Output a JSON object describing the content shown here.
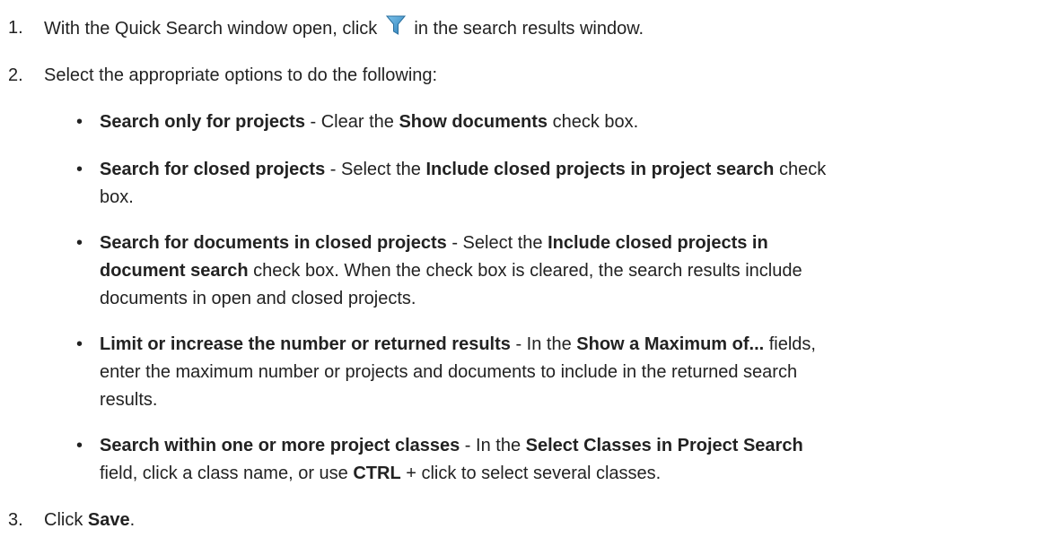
{
  "steps": {
    "step1": {
      "number": "1.",
      "text_before": "With the Quick Search window open, click",
      "text_after": "in the search results window."
    },
    "step2": {
      "number": "2.",
      "text": "Select the appropriate options to do the following:"
    },
    "step3": {
      "number": "3.",
      "text_before": "Click",
      "bold": "Save",
      "text_after": "."
    }
  },
  "bullets": {
    "b1": {
      "title": "Search only for projects",
      "t1": " - Clear the ",
      "b1": "Show documents",
      "t2": " check box."
    },
    "b2": {
      "title": "Search for closed projects",
      "t1": " - Select the ",
      "b1": "Include closed projects in project search",
      "t2": " check",
      "line2": "box."
    },
    "b3": {
      "title": "Search for documents in closed projects",
      "t1": " - Select the ",
      "b1": "Include closed projects in",
      "line2_bold": "document search",
      "line2_t": " check box. When the check box is cleared, the search results include",
      "line3": "documents in open and closed projects."
    },
    "b4": {
      "title": "Limit or increase the number or returned results",
      "t1": " - In the ",
      "b1": "Show a Maximum of...",
      "t2": " fields,",
      "line2": "enter the maximum number or projects and documents to include in the returned search",
      "line3": "results."
    },
    "b5": {
      "title": "Search within one or more project classes",
      "t1": " - In the ",
      "b1": "Select Classes in Project Search",
      "line2_t1": "field, click a class name, or use ",
      "line2_b": "CTRL",
      "line2_t2": " + click to select several classes."
    }
  },
  "icons": {
    "filter": {
      "name": "filter-icon",
      "color": "#3a8fc4"
    }
  }
}
